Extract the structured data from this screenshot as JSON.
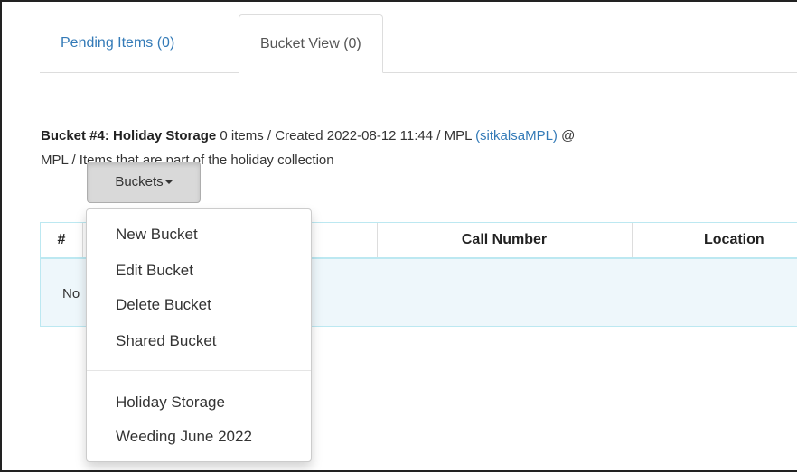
{
  "tabs": [
    {
      "label": "Pending Items (0)"
    },
    {
      "label": "Bucket View (0)"
    }
  ],
  "bucket": {
    "title": "Bucket #4: Holiday Storage",
    "meta": " 0 items / Created 2022-08-12 11:44 / MPL ",
    "owner": "(sitkalsaMPL)",
    "owner_suffix": " @",
    "line2": "MPL / Items that are part of the holiday collection"
  },
  "buckets_button": {
    "label": "Buckets"
  },
  "table": {
    "columns": [
      "#",
      "Call Number",
      "Location"
    ],
    "empty_text": "No"
  },
  "menu": {
    "items": [
      "New Bucket",
      "Edit Bucket",
      "Delete Bucket",
      "Shared Bucket"
    ],
    "buckets": [
      "Holiday Storage",
      "Weeding June 2022"
    ]
  }
}
